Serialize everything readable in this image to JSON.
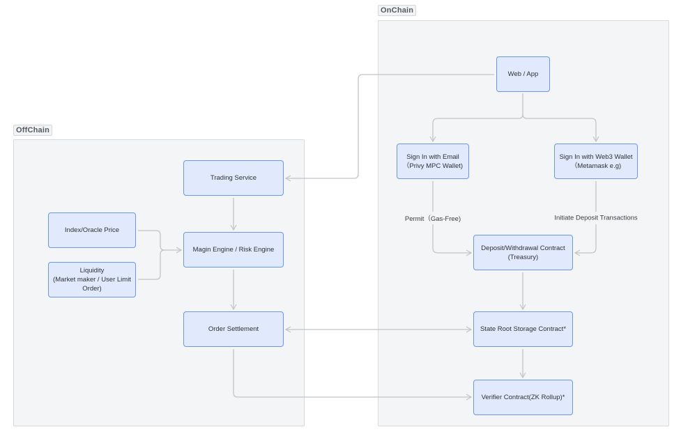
{
  "groups": {
    "offchain": {
      "label": "OffChain"
    },
    "onchain": {
      "label": "OnChain"
    }
  },
  "nodes": {
    "trading_service": "Trading Service",
    "index_oracle": "Index/Oracle Price",
    "margin_engine": "Magin Engine / Risk Engine",
    "liquidity": "Liquidity\n(Market maker / User Limit\nOrder)",
    "order_settlement": "Order Settlement",
    "web_app": "Web / App",
    "sign_in_email": "Sign In with Email\n（Privy MPC Wallet)",
    "sign_in_web3": "Sign In with Web3 Wallet\n（Metamask e.g)",
    "deposit_contract": "Deposit/Withdrawal Contract\n(Treasury)",
    "state_root": "State Root Storage Contract*",
    "verifier": "Verifier Contract(ZK Rollup)*"
  },
  "edge_labels": {
    "permit": "Permit（Gas-Free)",
    "initiate_deposit": "Initiate Deposit Transactions"
  },
  "colors": {
    "node_fill": "#e1eafc",
    "node_border": "#6b96ee",
    "edge": "#c2c4c8",
    "group_fill": "#f4f5f7"
  }
}
